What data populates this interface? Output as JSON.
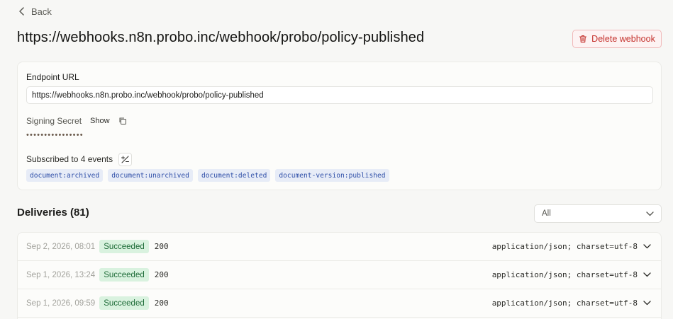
{
  "nav": {
    "back_label": "Back"
  },
  "header": {
    "title": "https://webhooks.n8n.probo.inc/webhook/probo/policy-published",
    "delete_label": "Delete webhook"
  },
  "config": {
    "endpoint_label": "Endpoint URL",
    "endpoint_value": "https://webhooks.n8n.probo.inc/webhook/probo/policy-published",
    "signing_secret_label": "Signing Secret",
    "show_label": "Show",
    "secret_masked": "••••••••••••••••",
    "events_label": "Subscribed to 4 events",
    "events": [
      "document:archived",
      "document:unarchived",
      "document:deleted",
      "document-version:published"
    ]
  },
  "deliveries": {
    "title": "Deliveries (81)",
    "filter_value": "All",
    "rows": [
      {
        "timestamp": "Sep 2, 2026, 08:01",
        "status": "Succeeded",
        "code": "200",
        "content_type": "application/json; charset=utf-8"
      },
      {
        "timestamp": "Sep 1, 2026, 13:24",
        "status": "Succeeded",
        "code": "200",
        "content_type": "application/json; charset=utf-8"
      },
      {
        "timestamp": "Sep 1, 2026, 09:59",
        "status": "Succeeded",
        "code": "200",
        "content_type": "application/json; charset=utf-8"
      }
    ]
  },
  "colors": {
    "danger": "#c4302b",
    "success_bg": "#d9f2df",
    "success_text": "#1d6b37",
    "tag_bg": "#e7ecf7",
    "tag_text": "#2f4fa8"
  }
}
